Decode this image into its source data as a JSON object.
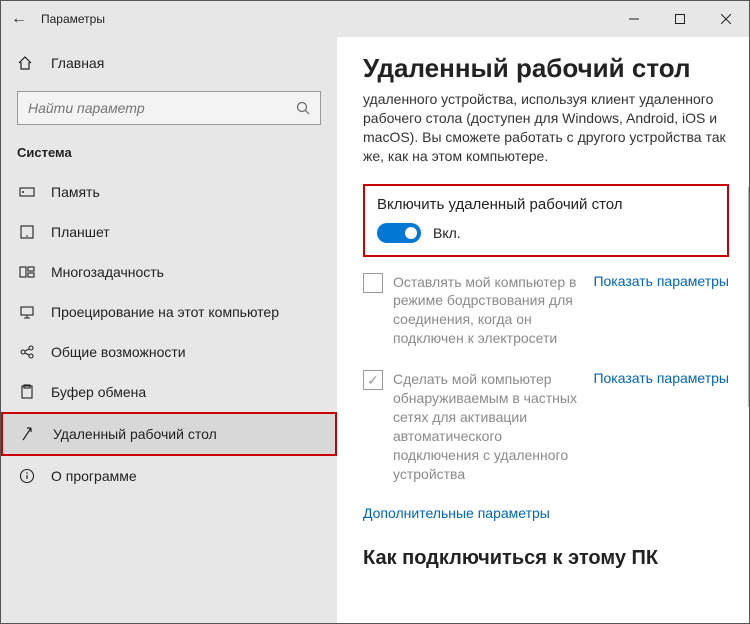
{
  "titlebar": {
    "back": "←",
    "title": "Параметры"
  },
  "home": {
    "label": "Главная"
  },
  "search": {
    "placeholder": "Найти параметр"
  },
  "category": "Система",
  "menu": {
    "items": [
      {
        "label": "Память"
      },
      {
        "label": "Планшет"
      },
      {
        "label": "Многозадачность"
      },
      {
        "label": "Проецирование на этот компьютер"
      },
      {
        "label": "Общие возможности"
      },
      {
        "label": "Буфер обмена"
      },
      {
        "label": "Удаленный рабочий стол"
      },
      {
        "label": "О программе"
      }
    ]
  },
  "content": {
    "heading": "Удаленный рабочий стол",
    "description": "удаленного устройства, используя клиент удаленного рабочего стола (доступен для Windows, Android, iOS и macOS). Вы сможете работать с другого устройства так же, как на этом компьютере.",
    "toggle": {
      "label": "Включить удаленный рабочий стол",
      "state": "Вкл."
    },
    "opt1": {
      "text": "Оставлять мой компьютер в режиме бодрствования для соединения, когда он подключен к электросети",
      "link": "Показать параметры"
    },
    "opt2": {
      "text": "Сделать мой компьютер обнаруживаемым в частных сетях для активации автоматического подключения с удаленного устройства",
      "link": "Показать параметры"
    },
    "advanced_link": "Дополнительные параметры",
    "subheading": "Как подключиться к этому ПК"
  }
}
